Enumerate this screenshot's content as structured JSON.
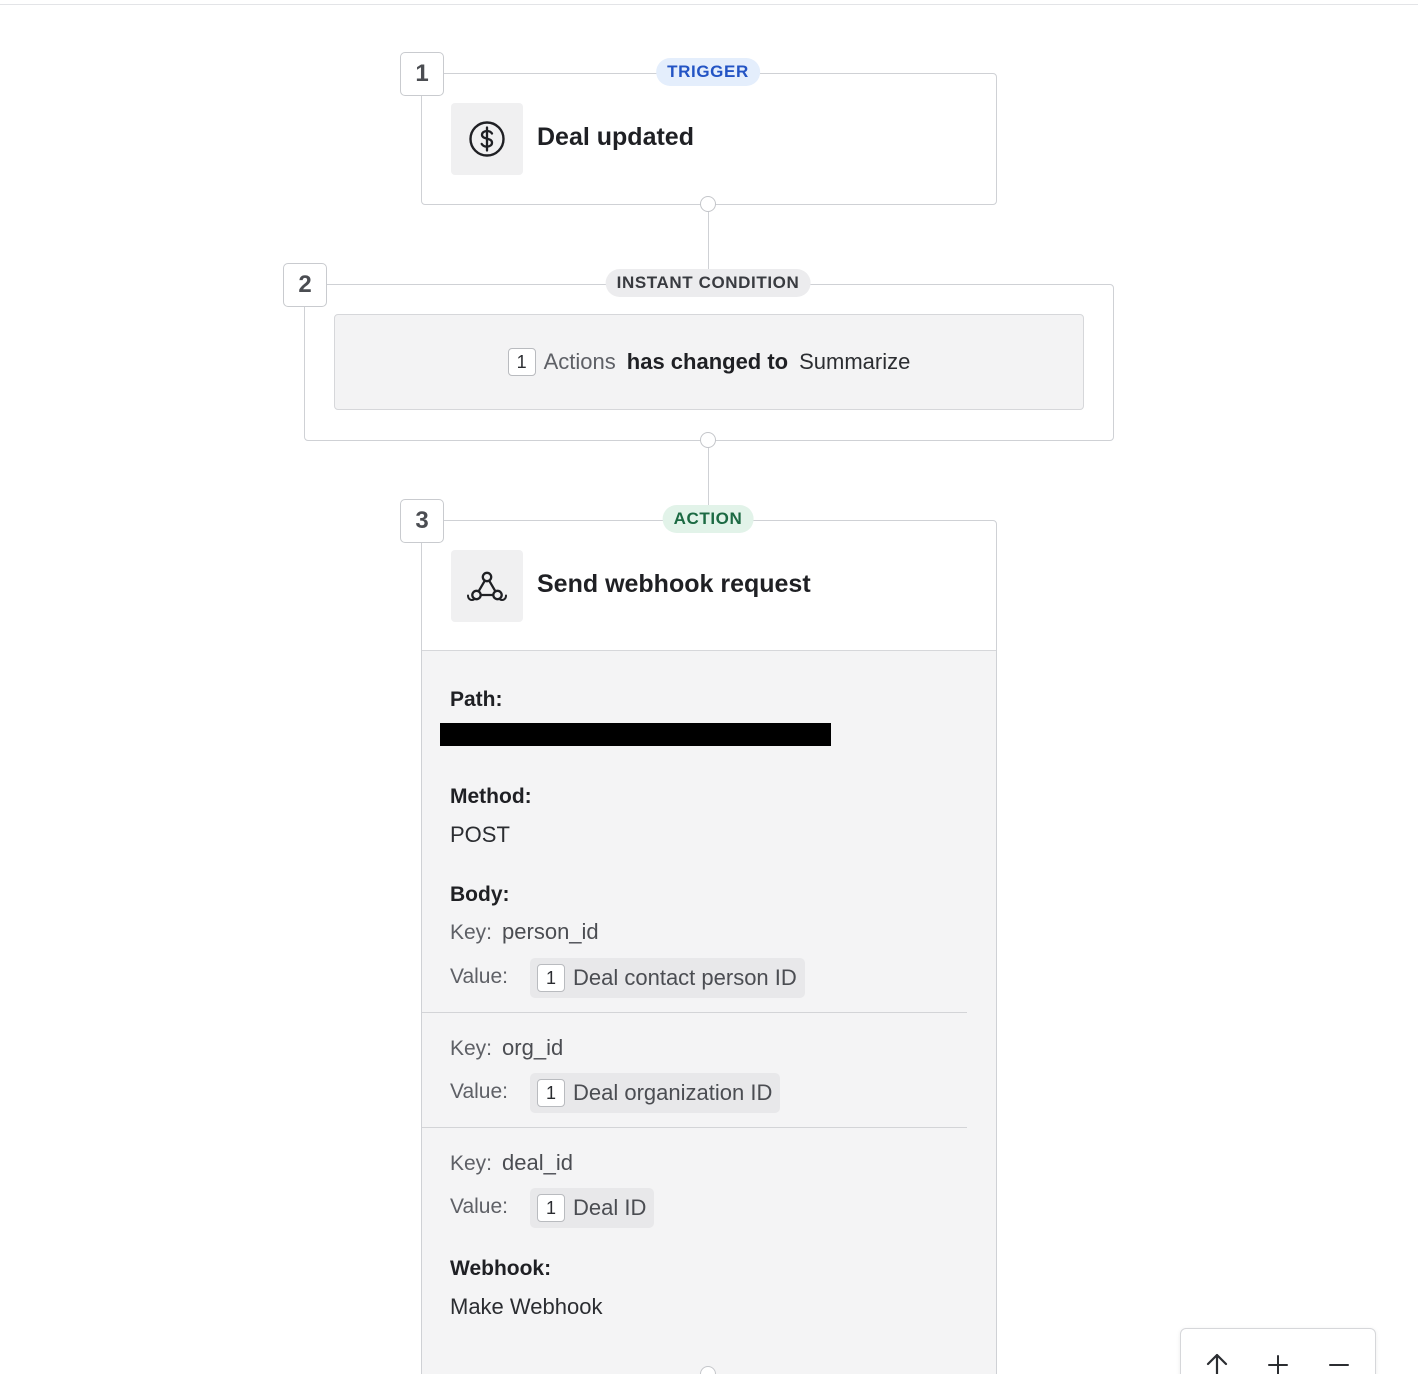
{
  "steps": [
    {
      "number": "1",
      "badge": "TRIGGER",
      "title": "Deal updated",
      "icon": "dollar-circle-icon"
    },
    {
      "number": "2",
      "badge": "INSTANT CONDITION"
    },
    {
      "number": "3",
      "badge": "ACTION",
      "title": "Send webhook request",
      "icon": "webhook-icon"
    }
  ],
  "condition": {
    "ref_step": "1",
    "field": "Actions",
    "operator": "has changed to",
    "value": "Summarize"
  },
  "action_details": {
    "path_label": "Path:",
    "method_label": "Method:",
    "method_value": "POST",
    "body_label": "Body:",
    "key_label": "Key:",
    "value_label": "Value:",
    "body": [
      {
        "key": "person_id",
        "value_step": "1",
        "value": "Deal contact person ID"
      },
      {
        "key": "org_id",
        "value_step": "1",
        "value": "Deal organization ID"
      },
      {
        "key": "deal_id",
        "value_step": "1",
        "value": "Deal ID"
      }
    ],
    "webhook_label": "Webhook:",
    "webhook_value": "Make Webhook"
  },
  "zoom_controls": [
    "arrow-up-icon",
    "zoom-in-icon",
    "zoom-out-icon"
  ],
  "colors": {
    "trigger_pill_bg": "#e4eefc",
    "trigger_pill_text": "#2354c4",
    "condition_pill_bg": "#ececee",
    "action_pill_bg": "#e2f3e9",
    "action_pill_text": "#1c6a43",
    "redaction": "#000000"
  }
}
